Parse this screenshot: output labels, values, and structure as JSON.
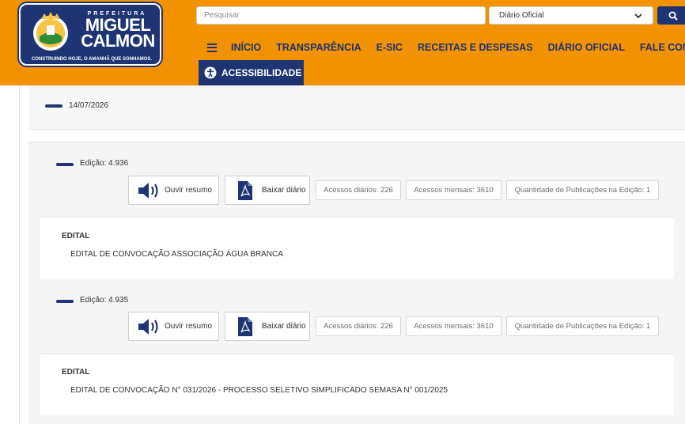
{
  "header": {
    "logo": {
      "prefix": "PREFEITURA",
      "name_line1": "MIGUEL",
      "name_line2": "CALMON",
      "slogan": "CONSTRUINDO HOJE, O AMANHÃ QUE SONHAMOS."
    },
    "search": {
      "placeholder": "Pesquisar",
      "value": ""
    },
    "select": {
      "selected": "Diário Oficial"
    },
    "search_icon": "search-icon",
    "nav": {
      "menu_icon": "hamburger-icon",
      "items": [
        "INÍCIO",
        "TRANSPARÊNCIA",
        "E-SIC",
        "RECEITAS E DESPESAS",
        "DIÁRIO OFICIAL",
        "FALE CONOSCO"
      ]
    },
    "accessibility_label": "ACESSIBILIDADE"
  },
  "content": {
    "date": "14/07/2026",
    "editions": [
      {
        "label": "Edição: 4.936",
        "listen_label": "Ouvir resumo",
        "download_label": "Baixar diário",
        "daily_access": "Acessos diários: 226",
        "monthly_access": "Acessos mensais: 3610",
        "pub_count": "Quantidade de Publicações na Edição: 1",
        "publication": {
          "category": "EDITAL",
          "title": "EDITAL DE CONVOCAÇÃO ASSOCIAÇÃO ÁGUA BRANCA"
        }
      },
      {
        "label": "Edição: 4.935",
        "listen_label": "Ouvir resumo",
        "download_label": "Baixar diário",
        "daily_access": "Acessos diários: 226",
        "monthly_access": "Acessos mensais: 3610",
        "pub_count": "Quantidade de Publicações na Edição: 1",
        "publication": {
          "category": "EDITAL",
          "title": "EDITAL DE CONVOCAÇÃO N° 031/2026 - PROCESSO SELETIVO SIMPLIFICADO SEMASA N° 001/2025"
        }
      }
    ]
  },
  "colors": {
    "orange": "#f39200",
    "navy": "#1e3473"
  }
}
